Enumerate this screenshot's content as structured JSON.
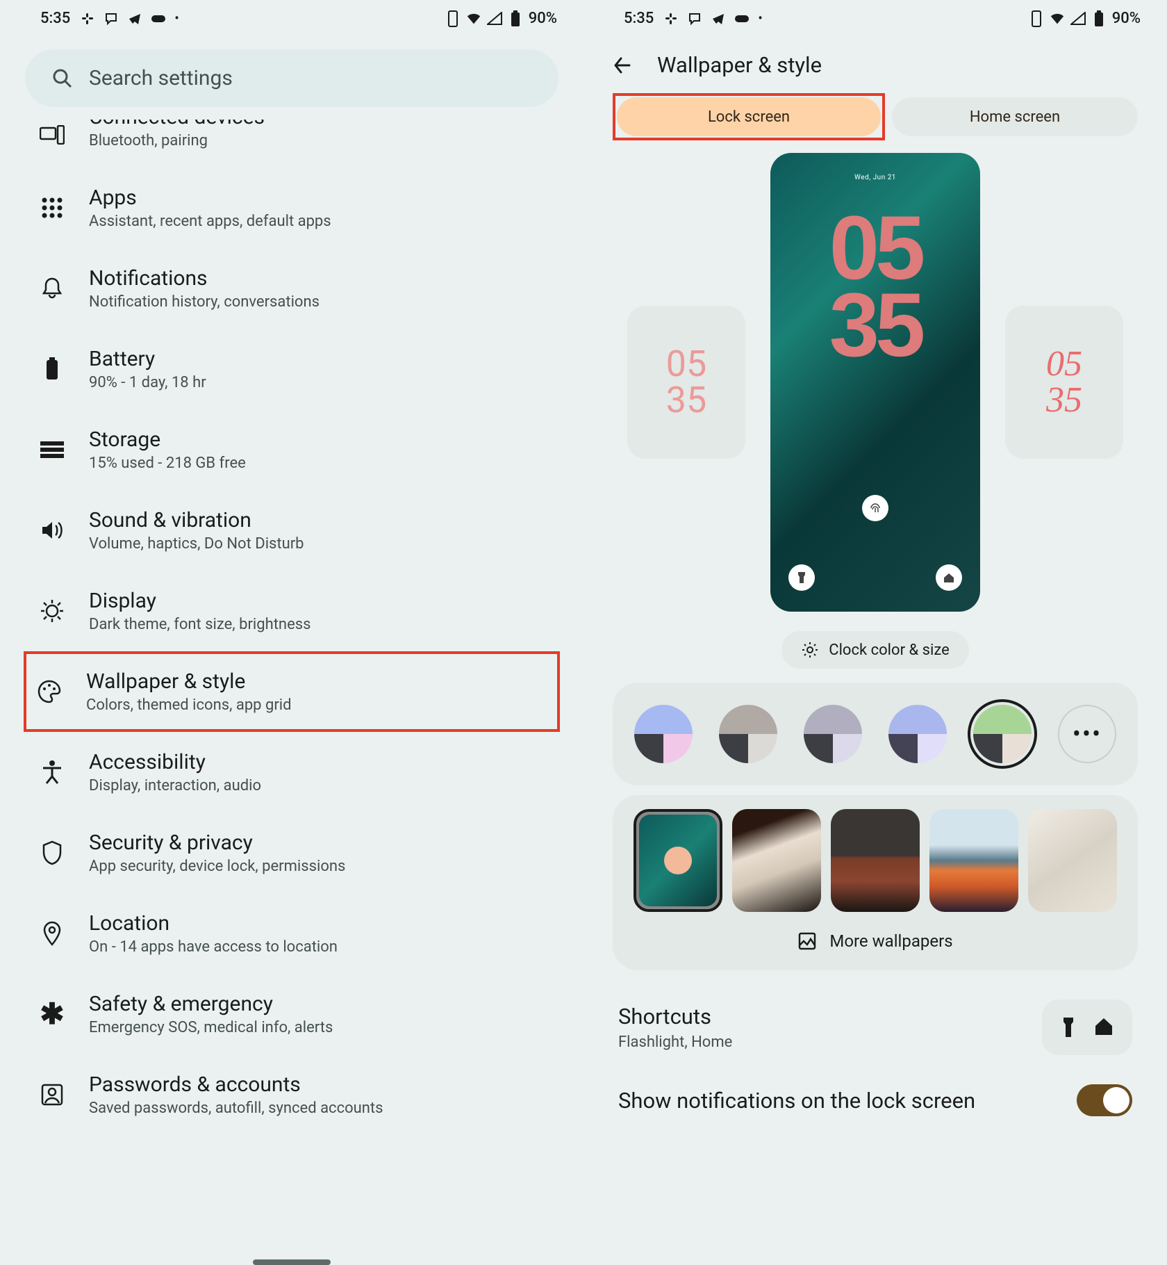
{
  "status": {
    "time": "5:35",
    "battery": "90%"
  },
  "left": {
    "search_placeholder": "Search settings",
    "items": [
      {
        "title": "Connected devices",
        "sub": "Bluetooth, pairing",
        "icon": "devices"
      },
      {
        "title": "Apps",
        "sub": "Assistant, recent apps, default apps",
        "icon": "apps"
      },
      {
        "title": "Notifications",
        "sub": "Notification history, conversations",
        "icon": "bell"
      },
      {
        "title": "Battery",
        "sub": "90% - 1 day, 18 hr",
        "icon": "battery"
      },
      {
        "title": "Storage",
        "sub": "15% used - 218 GB free",
        "icon": "storage"
      },
      {
        "title": "Sound & vibration",
        "sub": "Volume, haptics, Do Not Disturb",
        "icon": "sound"
      },
      {
        "title": "Display",
        "sub": "Dark theme, font size, brightness",
        "icon": "display"
      },
      {
        "title": "Wallpaper & style",
        "sub": "Colors, themed icons, app grid",
        "icon": "palette",
        "highlight": true
      },
      {
        "title": "Accessibility",
        "sub": "Display, interaction, audio",
        "icon": "accessibility"
      },
      {
        "title": "Security & privacy",
        "sub": "App security, device lock, permissions",
        "icon": "shield"
      },
      {
        "title": "Location",
        "sub": "On - 14 apps have access to location",
        "icon": "pin"
      },
      {
        "title": "Safety & emergency",
        "sub": "Emergency SOS, medical info, alerts",
        "icon": "asterisk"
      },
      {
        "title": "Passwords & accounts",
        "sub": "Saved passwords, autofill, synced accounts",
        "icon": "account"
      }
    ]
  },
  "right": {
    "title": "Wallpaper & style",
    "tabs": {
      "lock": "Lock screen",
      "home": "Home screen",
      "selected": "lock"
    },
    "preview": {
      "date": "Wed, Jun 21",
      "clock_top": "05",
      "clock_bottom": "35",
      "side_clock_top": "05",
      "side_clock_bottom": "35"
    },
    "clock_chip": "Clock color & size",
    "colors": [
      {
        "top": "#a7b9f2",
        "bl": "#3d3d44",
        "br": "#f2c8e8"
      },
      {
        "top": "#b1a9a4",
        "bl": "#3d3d44",
        "br": "#dcdad6"
      },
      {
        "top": "#b1aebf",
        "bl": "#3d3d44",
        "br": "#dcdaea"
      },
      {
        "top": "#a9b7ee",
        "bl": "#434355",
        "br": "#e1defa"
      },
      {
        "top": "#a7d595",
        "bl": "#3d3d44",
        "br": "#e8dfd6",
        "selected": true
      }
    ],
    "wallpapers": [
      {
        "bg": "linear-gradient(135deg,#0e5a5a,#1a8075,#0a3838)",
        "selected": true,
        "dot": "#f2b99a"
      },
      {
        "bg": "linear-gradient(160deg,#2a1810 20%,#e8ddd0 40%,#d4c8b8 60%,#1a1410)"
      },
      {
        "bg": "linear-gradient(180deg,#3a3634 45%,#7a3c28 48%,#8b4530 70%,#1a1614)"
      },
      {
        "bg": "linear-gradient(180deg,#d4e4ed 35%,#5a7a8a 50%,#e67a3a 60%,#d05a2a 75%,#2a2030)"
      },
      {
        "bg": "linear-gradient(145deg,#f0ece4,#d8d2c6,#e8e2d8)"
      }
    ],
    "more_wallpapers": "More wallpapers",
    "shortcuts": {
      "title": "Shortcuts",
      "sub": "Flashlight, Home"
    },
    "notif_label": "Show notifications on the lock screen",
    "notif_on": true
  }
}
